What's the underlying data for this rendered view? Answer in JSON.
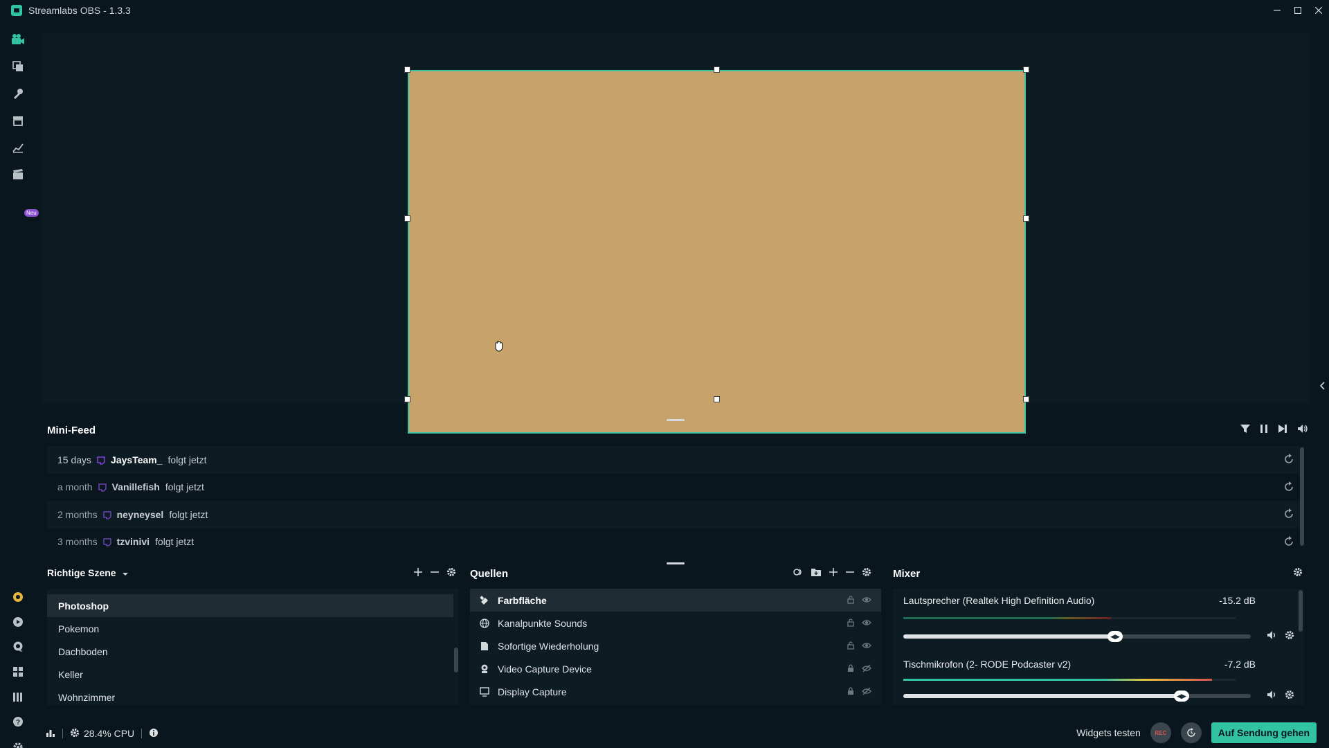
{
  "window": {
    "title": "Streamlabs OBS - 1.3.3"
  },
  "nav": {
    "new_badge": "Neu"
  },
  "minifeed": {
    "title": "Mini-Feed",
    "rows": [
      {
        "time": "15 days",
        "user": "JaysTeam_",
        "action": "folgt jetzt"
      },
      {
        "time": "a month",
        "user": "Vanillefish",
        "action": "folgt jetzt"
      },
      {
        "time": "2 months",
        "user": "neyneysel",
        "action": "folgt jetzt"
      },
      {
        "time": "3 months",
        "user": "tzvinivi",
        "action": "folgt jetzt"
      }
    ]
  },
  "scenes": {
    "collection": "Richtige Szene",
    "items": [
      "Photoshop",
      "Pokemon",
      "Dachboden",
      "Keller",
      "Wohnzimmer"
    ],
    "selected": "Photoshop"
  },
  "sources": {
    "title": "Quellen",
    "items": [
      {
        "name": "Farbfläche",
        "icon": "paint-icon"
      },
      {
        "name": "Kanalpunkte Sounds",
        "icon": "globe-icon"
      },
      {
        "name": "Sofortige Wiederholung",
        "icon": "file-icon"
      },
      {
        "name": "Video Capture Device",
        "icon": "camera-icon"
      },
      {
        "name": "Display Capture",
        "icon": "monitor-icon"
      }
    ],
    "selected": "Farbfläche"
  },
  "mixer": {
    "title": "Mixer",
    "channels": [
      {
        "name": "Lautsprecher (Realtek High Definition Audio)",
        "db": "-15.2 dB",
        "level": 0.61
      },
      {
        "name": "Tischmikrofon (2- RODE Podcaster v2)",
        "db": "-7.2 dB",
        "level": 0.8
      }
    ]
  },
  "footer": {
    "cpu": "28.4% CPU",
    "widgets": "Widgets testen",
    "rec": "REC",
    "go_live": "Auf Sendung gehen"
  },
  "colors": {
    "accent": "#31c3a2",
    "source_fill": "#c8a26b",
    "background": "#09161d"
  }
}
